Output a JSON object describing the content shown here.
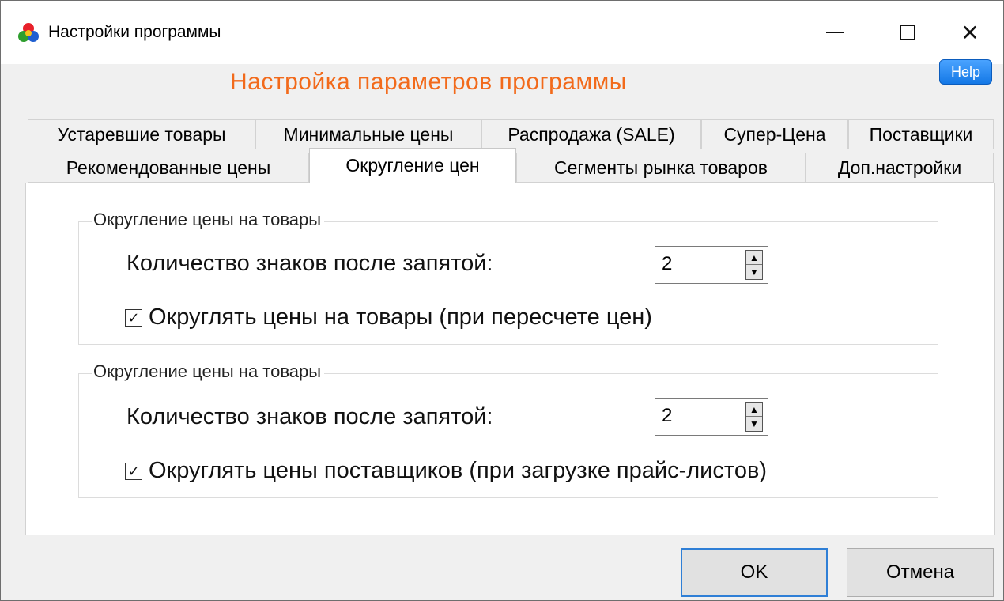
{
  "window": {
    "title": "Настройки программы",
    "controls": {
      "minimize": "—",
      "maximize": "☐",
      "close": "✕"
    }
  },
  "header": {
    "help_label": "Help",
    "main_title": "Настройка параметров программы",
    "title_color": "#f26a1b"
  },
  "tabs": {
    "row1": [
      "Устаревшие товары",
      "Минимальные цены",
      "Распродажа (SALE)",
      "Супер-Цена",
      "Поставщики"
    ],
    "row2": [
      "Рекомендованные цены",
      "Округление цен",
      "Сегменты рынка товаров",
      "Доп.настройки"
    ],
    "active": "Округление цен"
  },
  "groups": [
    {
      "legend": "Округление цены на товары",
      "field_label": "Количество знаков после запятой:",
      "spin_value": "2",
      "checkbox_label": "Округлять цены на товары (при пересчете цен)",
      "checked": true
    },
    {
      "legend": "Округление цены на товары",
      "field_label": "Количество знаков после запятой:",
      "spin_value": "2",
      "checkbox_label": "Округлять цены поставщиков (при загрузке прайс-листов)",
      "checked": true
    }
  ],
  "footer": {
    "ok_label": "OK",
    "cancel_label": "Отмена"
  },
  "icons": {
    "app": "app-logo-icon",
    "spin_up": "▲",
    "spin_down": "▼",
    "check": "✓"
  }
}
